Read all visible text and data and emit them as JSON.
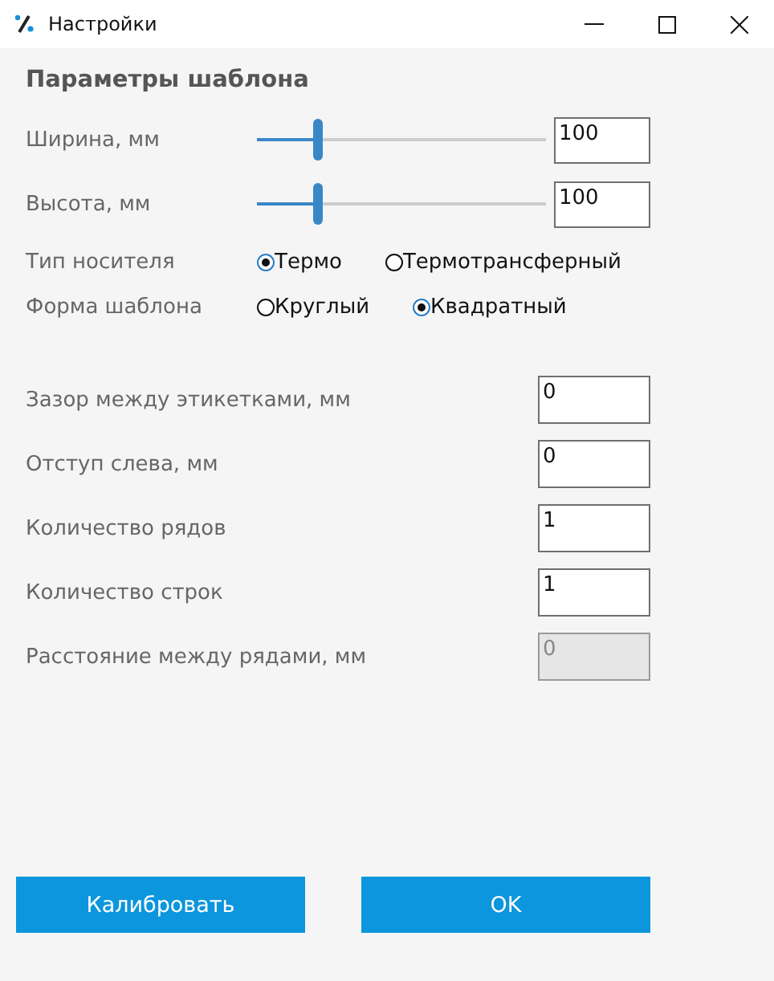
{
  "window": {
    "title": "Настройки"
  },
  "section_title": "Параметры шаблона",
  "sliders": [
    {
      "label": "Ширина, мм",
      "level": 0.21,
      "value": "100"
    },
    {
      "label": "Высота, мм",
      "level": 0.21,
      "value": "100"
    }
  ],
  "radio_groups": [
    {
      "label": "Тип носителя",
      "options": [
        {
          "label": "Термо",
          "selected": true
        },
        {
          "label": "Термотрансферный",
          "selected": false
        }
      ]
    },
    {
      "label": "Форма шаблона",
      "options": [
        {
          "label": "Круглый",
          "selected": false
        },
        {
          "label": "Квадратный",
          "selected": true
        }
      ]
    }
  ],
  "fields": [
    {
      "label": "Зазор между этикетками, мм",
      "value": "0",
      "disabled": false
    },
    {
      "label": "Отступ слева, мм",
      "value": "0",
      "disabled": false
    },
    {
      "label": "Количество рядов",
      "value": "1",
      "disabled": false
    },
    {
      "label": "Количество строк",
      "value": "1",
      "disabled": false
    },
    {
      "label": "Расстояние между рядами, мм",
      "value": "0",
      "disabled": true
    }
  ],
  "buttons": [
    "Калибровать",
    "OK"
  ]
}
